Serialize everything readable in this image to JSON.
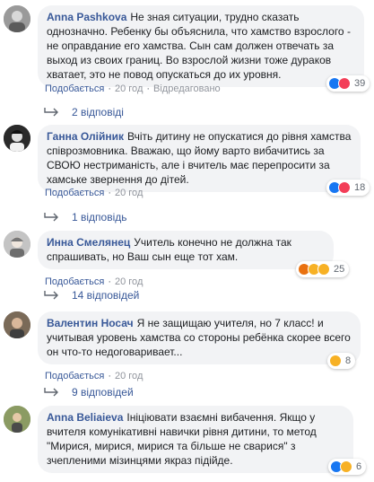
{
  "comments": [
    {
      "author": "Anna Pashkova",
      "text": "Не зная ситуации, трудно сказать однозначно. Ребенку бы объяснила, что хамство взрослого - не оправдание его хамства. Сын сам должен отвечать за выход из своих границ. Во взрослой жизни тоже дураков хватает, это не повод опускаться до их уровня.",
      "like_label": "Подобається",
      "time": "20 год",
      "edited_label": "Відредаговано",
      "reaction_count": "39",
      "replies_label": "2 відповіді"
    },
    {
      "author": "Ганна Олійник",
      "text": "Вчіть дитину не опускатися до рівня хамства співрозмовника. Вважаю, що йому варто вибачитись за СВОЮ нестриманість, але і вчитель має перепросити за хамське звернення до дітей.",
      "like_label": "Подобається",
      "time": "20 год",
      "reaction_count": "18",
      "replies_label": "1 відповідь"
    },
    {
      "author": "Инна Смелянец",
      "text": "Учитель конечно не должна так спрашивать, но Ваш сын еще тот хам.",
      "like_label": "Подобається",
      "time": "20 год",
      "reaction_count": "25",
      "replies_label": "14 відповідей"
    },
    {
      "author": "Валентин Носач",
      "text": "Я не защищаю учителя, но 7 класс! и учитывая уровень хамства со стороны ребёнка скорее всего он что-то недоговаривает...",
      "like_label": "Подобається",
      "time": "20 год",
      "reaction_count": "8",
      "replies_label": "9 відповідей"
    },
    {
      "author": "Anna Beliaieva",
      "text": "Ініціювати взаємні вибачення. Якщо у вчителя комунікативні навички рівня дитини, то метод \"Мирися, мирися, мирися та більше не сварися\" з зчепленими мізинцями якраз підійде.",
      "like_label": "Подобається",
      "time": "20 год",
      "reaction_count": "6"
    }
  ],
  "colors": {
    "link": "#385898",
    "bubble": "#f2f3f5",
    "like": "#1877f2",
    "love": "#f33e58",
    "haha": "#f7b125",
    "angry": "#e9710f"
  }
}
